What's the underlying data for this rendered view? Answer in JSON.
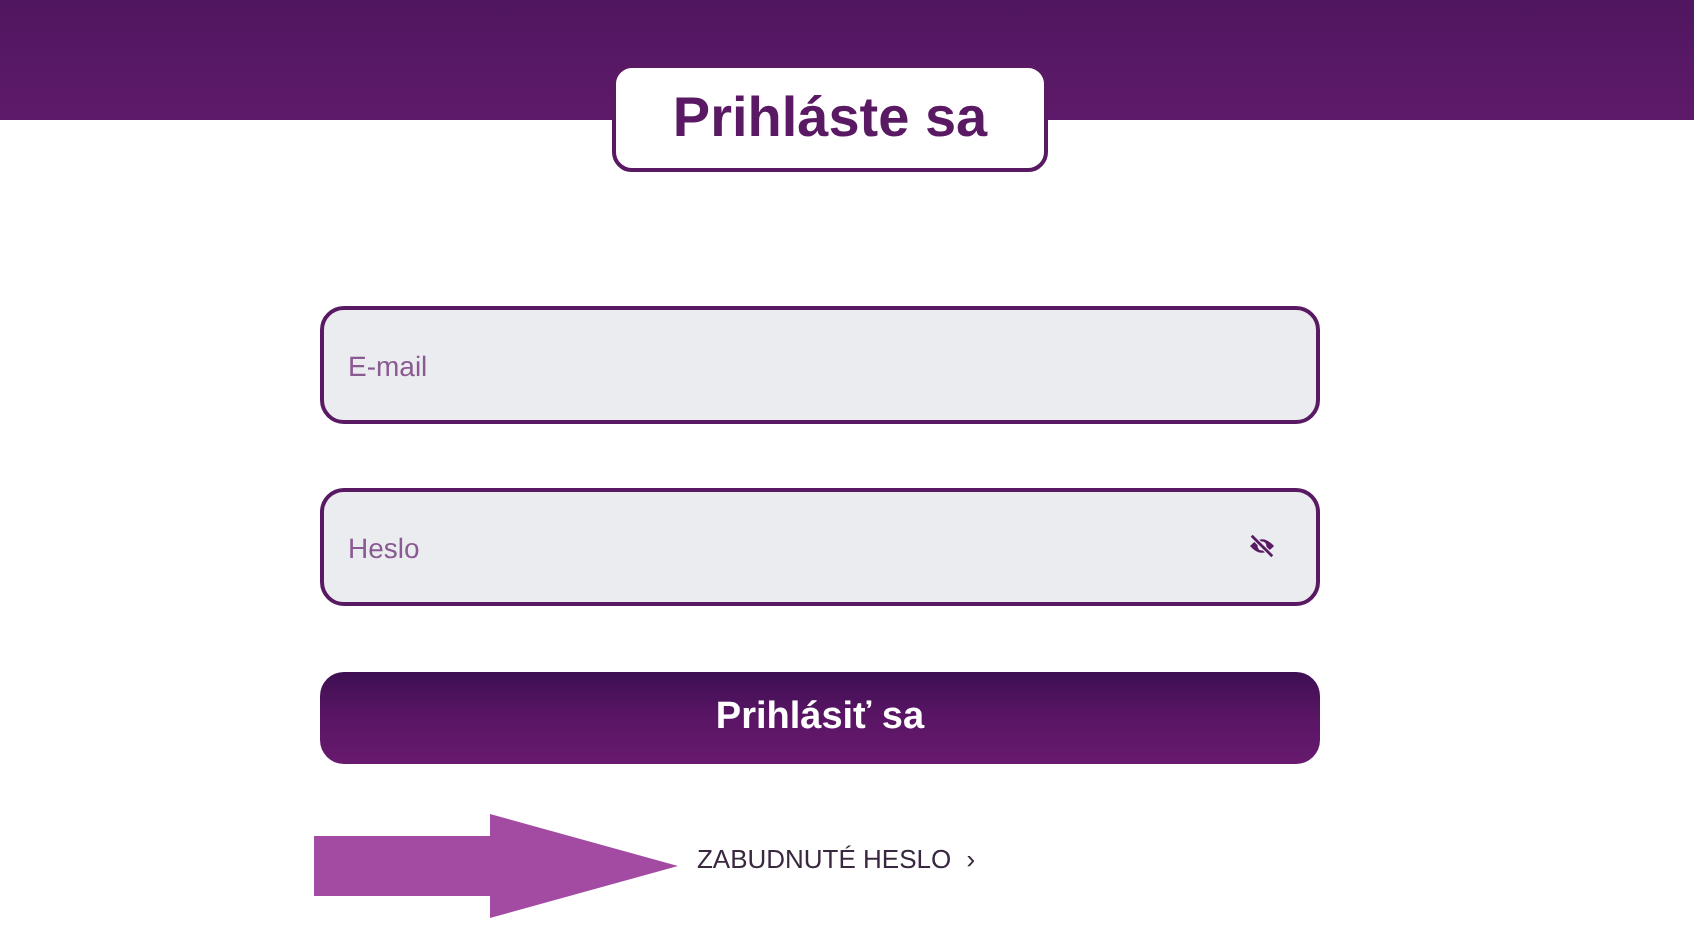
{
  "title": "Prihláste sa",
  "fields": [
    {
      "kind": "email",
      "placeholder": "E-mail"
    },
    {
      "kind": "password",
      "placeholder": "Heslo"
    }
  ],
  "submit_button": "Prihlásiť sa",
  "forgot_link": {
    "label": "ZABUDNUTÉ HESLO",
    "chevron": "›"
  }
}
